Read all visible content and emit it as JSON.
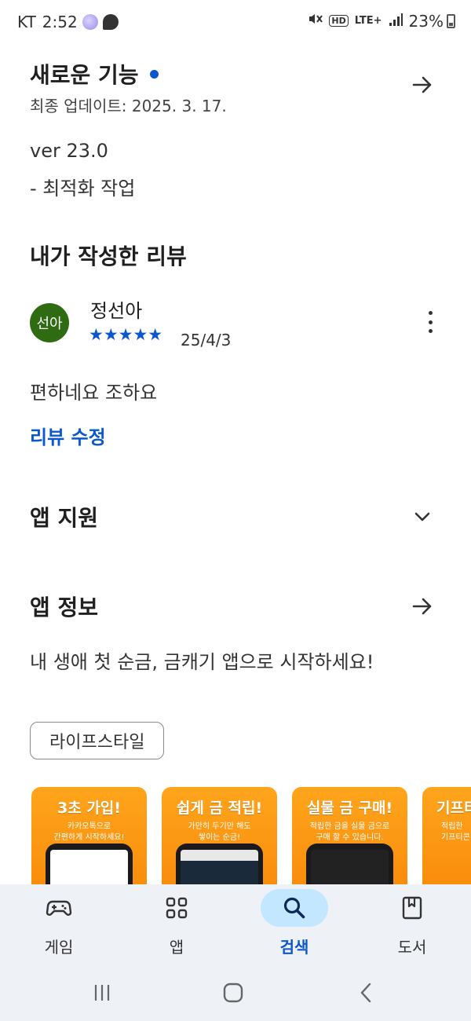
{
  "status_bar": {
    "carrier": "KT",
    "time": "2:52",
    "network": "LTE+",
    "hd": "HD",
    "battery": "23%"
  },
  "whats_new": {
    "title": "새로운 기능",
    "updated": "최종 업데이트: 2025. 3. 17.",
    "version": "ver 23.0",
    "note": "- 최적화 작업"
  },
  "my_review": {
    "title": "내가 작성한 리뷰",
    "avatar_text": "선아",
    "reviewer": "정선아",
    "stars": "★★★★★",
    "rating": 5,
    "date": "25/4/3",
    "text": "편하네요 조하요",
    "edit_label": "리뷰 수정"
  },
  "app_support": {
    "title": "앱 지원"
  },
  "app_info": {
    "title": "앱 정보",
    "description": "내 생애 첫 순금, 금캐기 앱으로 시작하세요!",
    "category": "라이프스타일"
  },
  "screenshots": [
    {
      "title": "3초 가입!",
      "sub": "카카오톡으로\n간편하게 시작하세요!"
    },
    {
      "title": "쉽게 금 적립!",
      "sub": "가만히 두기만 해도\n쌓이는 순금!"
    },
    {
      "title": "실물 금 구매!",
      "sub": "적립한 금을 실물 금으로\n구매 할 수 있습니다."
    },
    {
      "title": "기프티",
      "sub": "적립한\n기프티콘"
    }
  ],
  "bottom_nav": {
    "items": [
      {
        "label": "게임",
        "icon": "gamepad-icon"
      },
      {
        "label": "앱",
        "icon": "apps-grid-icon"
      },
      {
        "label": "검색",
        "icon": "search-icon",
        "active": true
      },
      {
        "label": "도서",
        "icon": "book-icon"
      }
    ]
  },
  "colors": {
    "accent": "#0b57d0",
    "avatar_bg": "#2e6b12",
    "nav_active_bg": "#c2e7ff",
    "nav_bg": "#eef1f6",
    "screenshot_orange": "#f98a0a"
  }
}
